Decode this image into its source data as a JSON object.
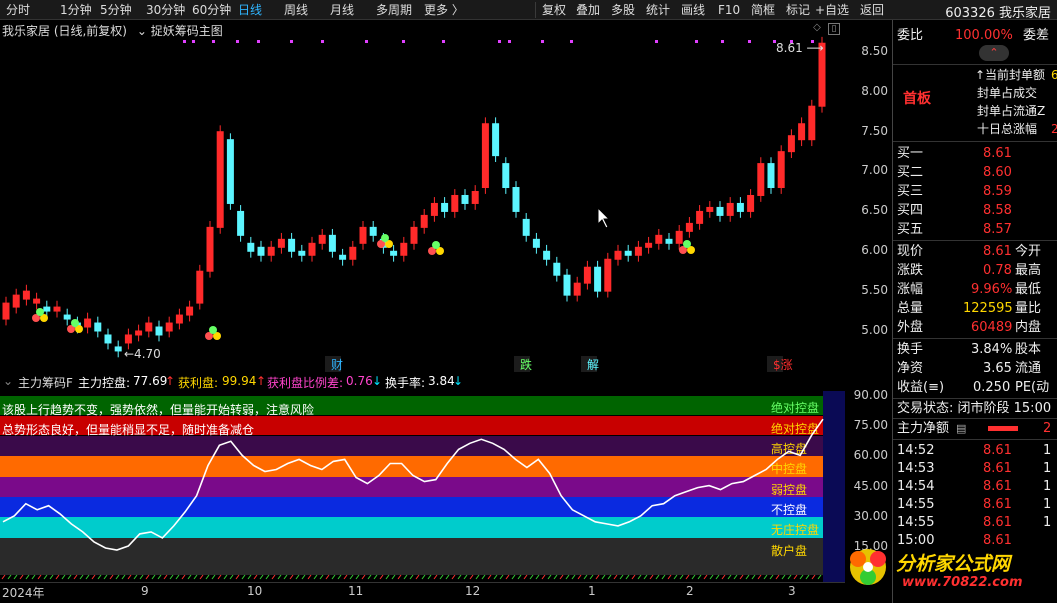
{
  "toolbar": {
    "periods": [
      "分时",
      "1分钟",
      "5分钟",
      "30分钟",
      "60分钟",
      "日线",
      "周线",
      "月线",
      "多周期",
      "更多 〉"
    ],
    "active_period": "日线",
    "tools": [
      "复权",
      "叠加",
      "多股",
      "统计",
      "画线",
      "F10",
      "简框",
      "标记",
      "+自选",
      "返回"
    ]
  },
  "stock": {
    "code_name": "603326 我乐家居"
  },
  "chart": {
    "title": "我乐家居 (日线,前复权)",
    "indicator": "捉妖筹码主图",
    "y_ticks": [
      "8.50",
      "8.00",
      "7.50",
      "7.00",
      "6.50",
      "6.00",
      "5.50",
      "5.00"
    ],
    "high_label": "8.61",
    "low_label": "←4.70",
    "event_tags": [
      "财",
      "跌",
      "解",
      "$涨"
    ]
  },
  "indicator": {
    "name": "主力筹码F",
    "main_label": "主力控盘:",
    "main_value": "77.69",
    "profit_label": "获利盘:",
    "profit_value": "99.94",
    "ratio_label": "获利盘比例差:",
    "ratio_value": "0.76",
    "turnover_label": "换手率:",
    "turnover_value": "3.84",
    "y_ticks": [
      "90.00",
      "75.00",
      "60.00",
      "45.00",
      "30.00",
      "15.00"
    ],
    "comment1": "该股上行趋势不变，强势依然，但量能开始转弱，注意风险",
    "comment2": "总势形态良好，但量能稍显不足，随时准备减仓",
    "bands": [
      "绝对控盘",
      "绝对控盘",
      "高控盘",
      "中控盘",
      "弱控盘",
      "不控盘",
      "无庄控盘",
      "散户盘"
    ],
    "colors": {
      "band1": "#006400",
      "band2": "#c80000",
      "band3": "#3a0a4a",
      "band4": "#ff6a00",
      "band5": "#7a0a8a",
      "band6": "#0a2ae0",
      "band7": "#00cccc",
      "band8": "#2a2a2a"
    }
  },
  "x_labels": [
    "2024年",
    "9",
    "10",
    "11",
    "12",
    "1",
    "2",
    "3"
  ],
  "right_panel": {
    "webi_label": "委比",
    "webi_value": "100.00%",
    "weicha_label": "委差",
    "limit_up_label": "首板",
    "seal_rows": [
      "↑当前封单额",
      "封单占成交",
      "封单占流通Z",
      "十日总涨幅"
    ],
    "seal_values": [
      "6",
      "",
      "",
      "2"
    ],
    "bids": [
      {
        "label": "买一",
        "price": "8.61"
      },
      {
        "label": "买二",
        "price": "8.60"
      },
      {
        "label": "买三",
        "price": "8.59"
      },
      {
        "label": "买四",
        "price": "8.58"
      },
      {
        "label": "买五",
        "price": "8.57"
      }
    ],
    "quote": [
      {
        "l": "现价",
        "v": "8.61",
        "r": "今开"
      },
      {
        "l": "涨跌",
        "v": "0.78",
        "r": "最高"
      },
      {
        "l": "涨幅",
        "v": "9.96%",
        "r": "最低"
      },
      {
        "l": "总量",
        "v": "122595",
        "r": "量比"
      },
      {
        "l": "外盘",
        "v": "60489",
        "r": "内盘"
      }
    ],
    "stats": [
      {
        "l": "换手",
        "v": "3.84%",
        "r": "股本"
      },
      {
        "l": "净资",
        "v": "3.65",
        "r": "流通"
      },
      {
        "l": "收益(≡)",
        "v": "0.250",
        "r": "PE(动"
      }
    ],
    "trade_status": "交易状态: 闭市阶段 15:00",
    "net_flow_label": "主力净额",
    "ticks": [
      {
        "t": "14:52",
        "p": "8.61",
        "v": "1"
      },
      {
        "t": "14:53",
        "p": "8.61",
        "v": "1"
      },
      {
        "t": "14:54",
        "p": "8.61",
        "v": "1"
      },
      {
        "t": "14:55",
        "p": "8.61",
        "v": "1"
      },
      {
        "t": "14:55",
        "p": "8.61",
        "v": "1"
      },
      {
        "t": "15:00",
        "p": "8.61",
        "v": ""
      }
    ]
  },
  "watermark": {
    "text": "分析家公式网",
    "url": "www.70822.com"
  }
}
